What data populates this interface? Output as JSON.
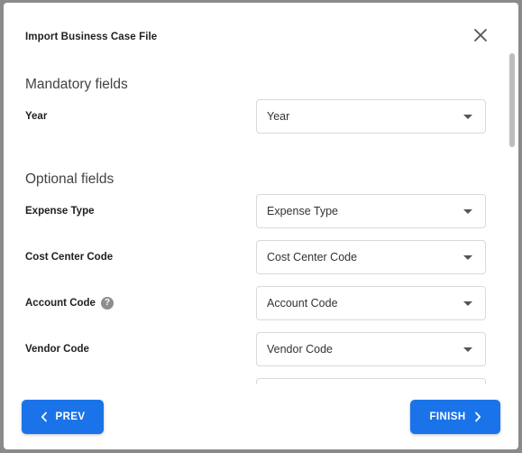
{
  "dialog": {
    "title": "Import Business Case File"
  },
  "sections": {
    "mandatory_heading": "Mandatory fields",
    "optional_heading": "Optional fields"
  },
  "fields": {
    "year": {
      "label": "Year",
      "value": "Year"
    },
    "expense_type": {
      "label": "Expense Type",
      "value": "Expense Type"
    },
    "cost_center_code": {
      "label": "Cost Center Code",
      "value": "Cost Center Code"
    },
    "account_code": {
      "label": "Account Code",
      "value": "Account Code",
      "help_icon": "?"
    },
    "vendor_code": {
      "label": "Vendor Code",
      "value": "Vendor Code"
    }
  },
  "buttons": {
    "prev_label": "PREV",
    "finish_label": "FINISH"
  },
  "colors": {
    "primary": "#1a73e8",
    "overlay": "#8a8a8a"
  },
  "icons": {
    "close": "close-icon",
    "prev": "chevron-left-icon",
    "next": "chevron-right-icon",
    "help": "help-icon",
    "dropdown": "caret-down-icon"
  }
}
